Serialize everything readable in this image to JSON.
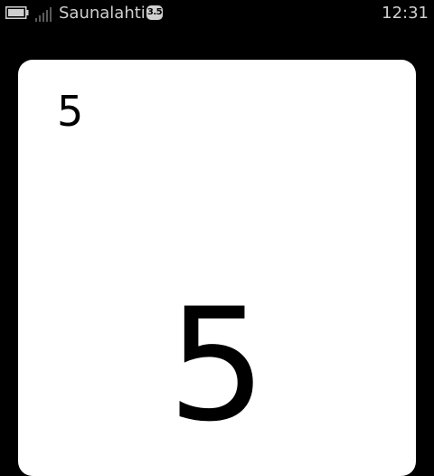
{
  "status_bar": {
    "carrier": "Saunalahti",
    "network": "3.5",
    "time": "12:31"
  },
  "card": {
    "corner_rank": "5",
    "center_rank": "5"
  },
  "colors": {
    "background": "#000000",
    "card": "#ffffff",
    "status_text": "#cfcfcf"
  },
  "icons": [
    "battery-icon",
    "signal-strength-icon",
    "network-type-badge"
  ]
}
